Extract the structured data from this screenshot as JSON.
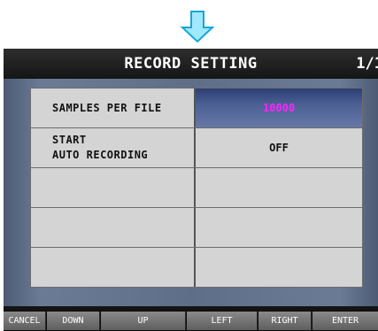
{
  "header": {
    "title": "RECORD SETTING",
    "page": "1/1"
  },
  "settings": [
    {
      "label_lines": [
        "SAMPLES PER FILE"
      ],
      "value": "10000",
      "selected": true
    },
    {
      "label_lines": [
        "START",
        "AUTO RECORDING"
      ],
      "value": "OFF",
      "selected": false
    },
    {
      "label_lines": [],
      "value": ""
    },
    {
      "label_lines": [],
      "value": ""
    },
    {
      "label_lines": [],
      "value": ""
    }
  ],
  "function_keys": {
    "cancel": "CANCEL",
    "down": "DOWN",
    "up": "UP",
    "left": "LEFT",
    "right": "RIGHT",
    "enter": "ENTER"
  },
  "colors": {
    "selected_value_text": "#ff22ff",
    "panel_blue": "#6b7b96",
    "cell_gray": "#d4d4d4"
  },
  "icons": {
    "top_indicator": "arrow-down-icon"
  }
}
